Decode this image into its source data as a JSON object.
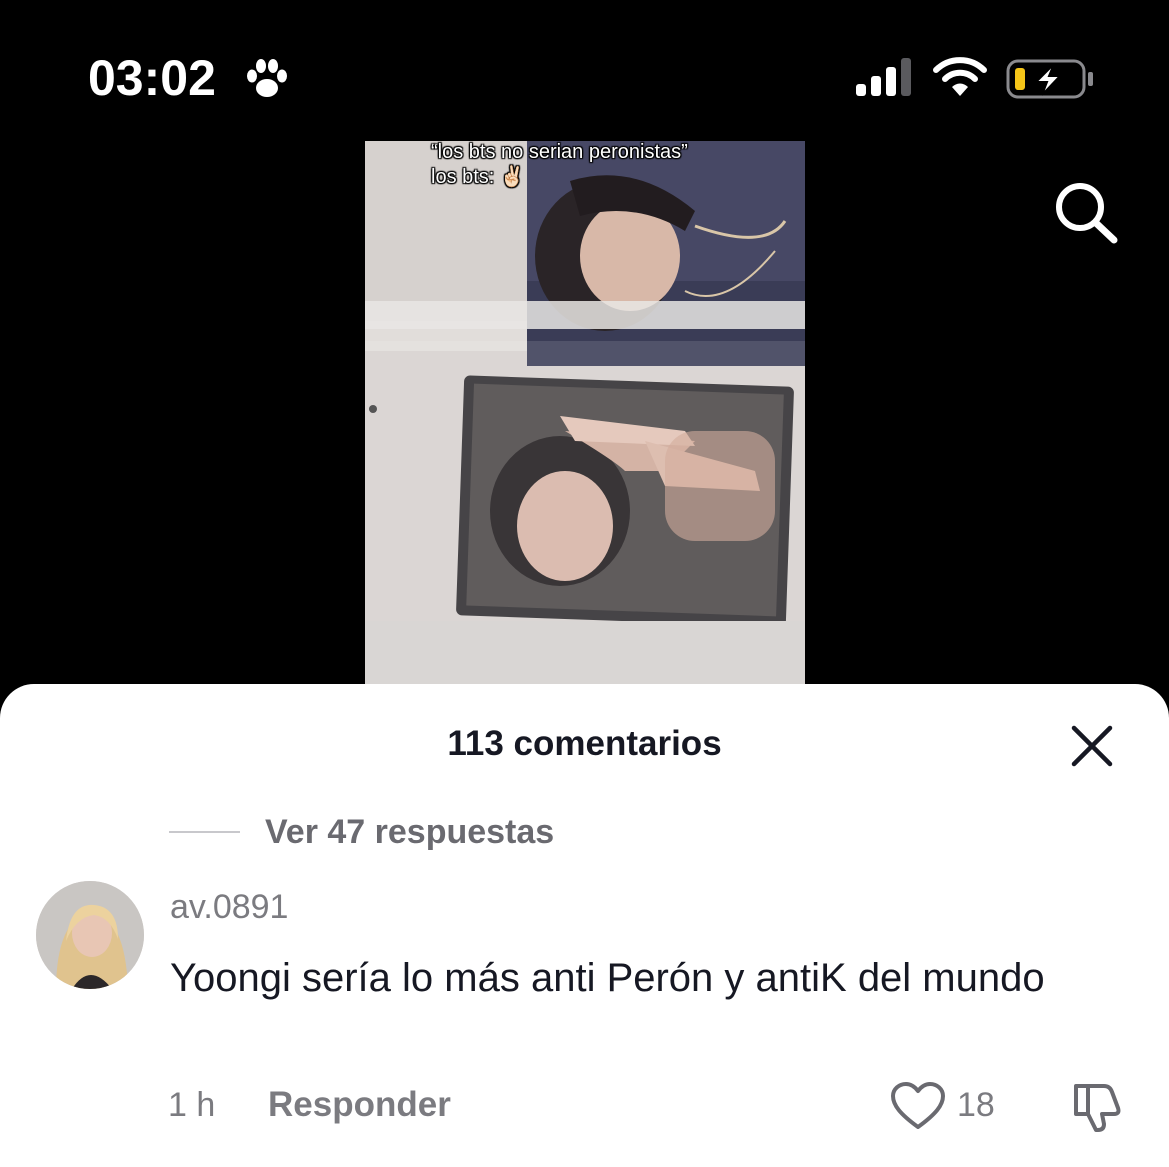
{
  "status_bar": {
    "time": "03:02",
    "icons": [
      "paw-icon",
      "signal-icon",
      "wifi-icon",
      "battery-charging-icon"
    ],
    "battery_color": "#f5c518"
  },
  "video": {
    "overlay_line_1": "“los bts no serian peronistas”",
    "overlay_line_2": "los bts: ✌🏻"
  },
  "comments": {
    "title": "113 comentarios",
    "view_replies": "Ver 47 respuestas",
    "items": [
      {
        "username": "av.0891",
        "text": "Yoongi sería lo más anti Perón y antiK del mundo",
        "time": "1 h",
        "reply_label": "Responder",
        "likes": "18"
      }
    ]
  },
  "colors": {
    "background": "#000000",
    "sheet": "#ffffff",
    "primary_text": "#161823",
    "secondary_text": "#7b7b80"
  }
}
